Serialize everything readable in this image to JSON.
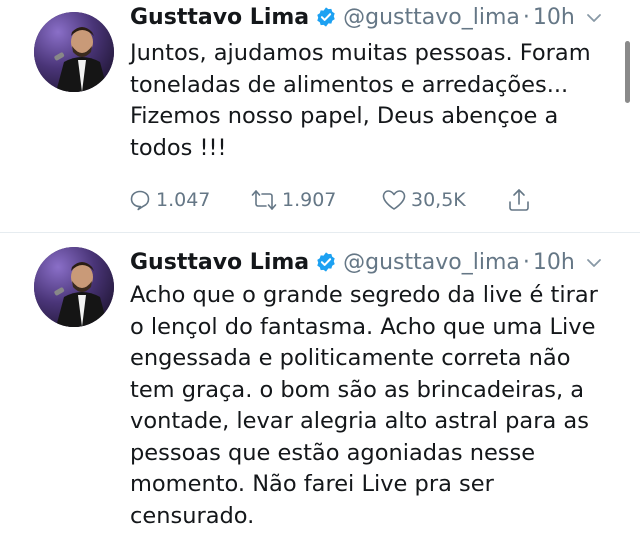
{
  "tweets": [
    {
      "name": "Gusttavo Lima",
      "handle": "@gusttavo_lima",
      "separator": "·",
      "time": "10h",
      "text": "Juntos, ajudamos muitas pessoas. Foram\ntoneladas de alimentos e arredações...\nFizemos nosso papel, Deus abençoe a\ntodos !!!",
      "replies": "1.047",
      "retweets": "1.907",
      "likes": "30,5K"
    },
    {
      "name": "Gusttavo Lima",
      "handle": "@gusttavo_lima",
      "separator": "·",
      "time": "10h",
      "text": "Acho que o grande segredo da live é tirar\no lençol do fantasma. Acho que uma Live\nengessada e politicamente correta não\ntem graça. o bom são as brincadeiras, a\nvontade, levar alegria alto astral para as\npessoas que estão agoniadas nesse\nmomento. Não farei Live pra ser\ncensurado."
    }
  ],
  "colors": {
    "text": "#14171a",
    "secondary": "#657786",
    "verified": "#1da1f2",
    "divider": "#e6ecf0"
  },
  "icons": {
    "reply": "speech-bubble-icon",
    "retweet": "retweet-icon",
    "like": "heart-icon",
    "share": "share-icon",
    "verified": "verified-badge-icon",
    "more": "chevron-down-icon"
  }
}
